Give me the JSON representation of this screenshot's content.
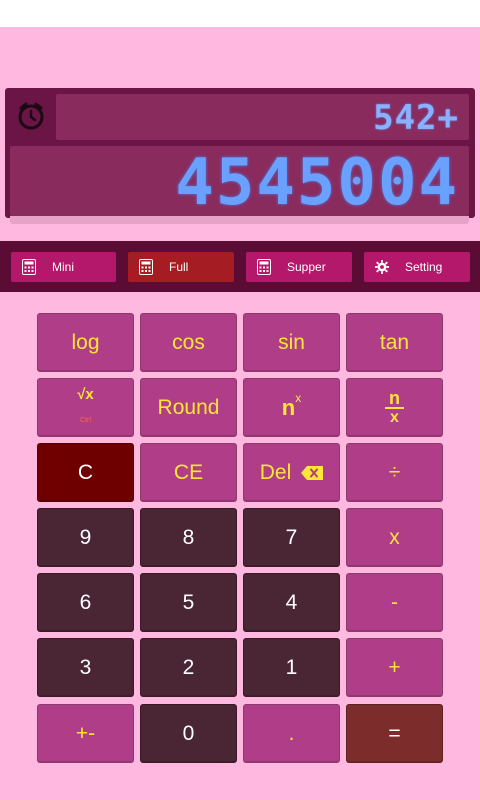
{
  "display": {
    "history_expression": "542+",
    "main_value": "4545004",
    "history_icon": "history-clock-icon"
  },
  "modes": [
    {
      "label": "Mini",
      "icon": "calculator-icon",
      "active": false
    },
    {
      "label": "Full",
      "icon": "calculator-icon",
      "active": true
    },
    {
      "label": "Supper",
      "icon": "calculator-icon",
      "active": false
    },
    {
      "label": "Setting",
      "icon": "gear-icon",
      "active": false
    }
  ],
  "keys": {
    "log": "log",
    "cos": "cos",
    "sin": "sin",
    "tan": "tan",
    "sqrt": "√x",
    "sqrt_sub": "Ctrl",
    "round": "Round",
    "power_base": "n",
    "power_exp": "x",
    "frac_top": "n",
    "frac_bottom": "x",
    "clear": "C",
    "clear_entry": "CE",
    "delete": "Del",
    "divide": "÷",
    "nine": "9",
    "eight": "8",
    "seven": "7",
    "multiply": "x",
    "six": "6",
    "five": "5",
    "four": "4",
    "minus": "-",
    "three": "3",
    "two": "2",
    "one": "1",
    "plus": "+",
    "plus_minus": "+-",
    "zero": "0",
    "dot": ".",
    "equals": "="
  },
  "colors": {
    "background": "#ffb9e0",
    "display_frame": "#6a1546",
    "display_screen": "#8a2b5e",
    "digit": "#6aa0ff",
    "mode_bar": "#5a0c34",
    "mode_active": "#a51d22",
    "mode_inactive": "#b4186a",
    "key_function": "#b03d88",
    "key_number": "#4a2534",
    "key_clear": "#6e0000",
    "key_equals": "#7c2d2b",
    "key_accent_text": "#ffe635"
  }
}
